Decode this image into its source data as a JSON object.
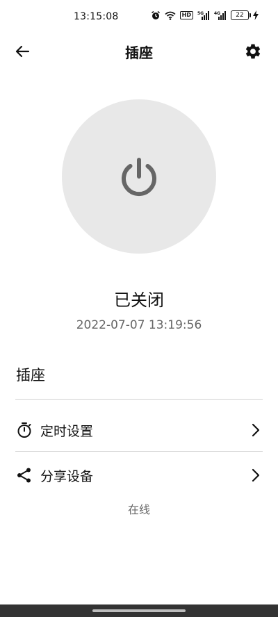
{
  "status_bar": {
    "time": "13:15:08",
    "hd_label": "HD",
    "battery_level": "22",
    "icons": [
      "alarm-icon",
      "wifi-icon",
      "hd-icon",
      "signal-5g-icon",
      "signal-4g-icon",
      "battery-icon",
      "charging-icon"
    ]
  },
  "app_bar": {
    "title": "插座",
    "back_icon": "arrow-left-icon",
    "settings_icon": "gear-icon"
  },
  "power": {
    "icon": "power-icon",
    "state_label": "已关闭",
    "state_time": "2022-07-07 13:19:56"
  },
  "device": {
    "name": "插座"
  },
  "menu": {
    "timer": {
      "label": "定时设置",
      "icon": "timer-icon"
    },
    "share": {
      "label": "分享设备",
      "icon": "share-icon"
    }
  },
  "online_status": "在线"
}
